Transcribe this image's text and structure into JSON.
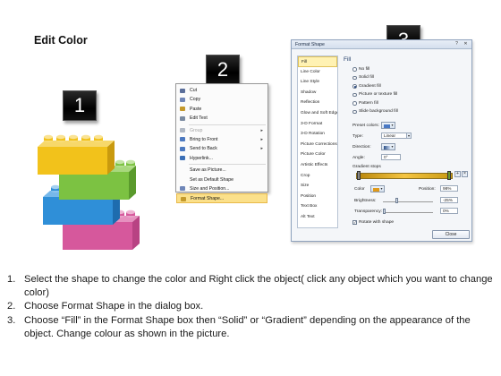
{
  "page": {
    "title": "Edit Color"
  },
  "badges": {
    "step1": "1",
    "step2": "2",
    "step3": "3"
  },
  "context_menu": {
    "items": [
      {
        "label": "Cut",
        "underline": "t",
        "disabled": false,
        "icon_color": "#5a6e9a",
        "submenu": false
      },
      {
        "label": "Copy",
        "disabled": false,
        "icon_color": "#6f86b8",
        "submenu": false
      },
      {
        "label": "Paste",
        "disabled": false,
        "icon_color": "#c4992c",
        "submenu": false
      },
      {
        "label": "Edit Text",
        "disabled": false,
        "icon_color": "#7a8aa0",
        "submenu": false
      },
      {
        "separator": true
      },
      {
        "label": "Group",
        "disabled": true,
        "icon_color": "#b0b8c4",
        "submenu": true
      },
      {
        "label": "Bring to Front",
        "disabled": false,
        "icon_color": "#4c79c0",
        "submenu": true
      },
      {
        "label": "Send to Back",
        "disabled": false,
        "icon_color": "#4c79c0",
        "submenu": true
      },
      {
        "label": "Hyperlink...",
        "disabled": false,
        "icon_color": "#3b6fb6",
        "submenu": false
      },
      {
        "separator": true
      },
      {
        "label": "Save as Picture...",
        "disabled": false,
        "icon_color": null,
        "submenu": false
      },
      {
        "label": "Set as Default Shape",
        "disabled": false,
        "icon_color": null,
        "submenu": false
      },
      {
        "label": "Size and Position...",
        "disabled": false,
        "icon_color": "#6f86b8",
        "submenu": false
      },
      {
        "label": "Format Shape...",
        "disabled": false,
        "icon_color": "#c49a2c",
        "submenu": false,
        "highlighted": true
      }
    ]
  },
  "dialog": {
    "title": "Format Shape",
    "help_icon": "?",
    "close_icon": "✕",
    "nav": [
      "Fill",
      "Line Color",
      "Line Style",
      "Shadow",
      "Reflection",
      "Glow and Soft Edges",
      "3-D Format",
      "3-D Rotation",
      "Picture Corrections",
      "Picture Color",
      "Artistic Effects",
      "Crop",
      "Size",
      "Position",
      "Text Box",
      "Alt Text"
    ],
    "selected_nav": 0,
    "panel": {
      "heading": "Fill",
      "options": [
        {
          "label": "No fill",
          "selected": false
        },
        {
          "label": "Solid fill",
          "selected": false
        },
        {
          "label": "Gradient fill",
          "selected": true
        },
        {
          "label": "Picture or texture fill",
          "selected": false
        },
        {
          "label": "Pattern fill",
          "selected": false
        },
        {
          "label": "Slide background fill",
          "selected": false
        }
      ],
      "preset_label": "Preset colors:",
      "type_label": "Type:",
      "type_value": "Linear",
      "direction_label": "Direction:",
      "angle_label": "Angle:",
      "angle_value": "0°",
      "stops_label": "Gradient stops",
      "color_label": "Color",
      "position_label": "Position:",
      "position_value": "98%",
      "brightness_label": "Brightness:",
      "brightness_value": "-25%",
      "transparency_label": "Transparency:",
      "transparency_value": "0%",
      "rotate_label": "Rotate with shape",
      "rotate_checked": true,
      "close_label": "Close"
    },
    "colors": {
      "gradient_start": "#b8860b",
      "gradient_mid": "#f5c542",
      "gradient_end": "#c99a12"
    }
  },
  "bricks": {
    "colors": {
      "yellow": "#f2c21b",
      "green": "#7cc242",
      "blue": "#2f8fd8",
      "pink": "#d6589c"
    }
  },
  "instructions": [
    {
      "num": "1.",
      "text": "Select the shape to change the color and Right click the object( click any object which you want to change color)"
    },
    {
      "num": "2.",
      "text": "Choose Format Shape in the dialog box."
    },
    {
      "num": "3.",
      "text": "Choose “Fill” in the Format Shape box then “Solid” or “Gradient” depending on the appearance of the object. Change colour as shown in the picture."
    }
  ]
}
